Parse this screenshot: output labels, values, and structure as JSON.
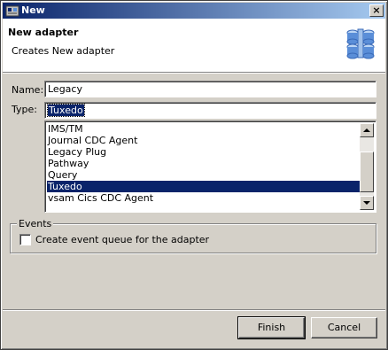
{
  "window": {
    "title": "New",
    "close_label": "×"
  },
  "banner": {
    "title": "New adapter",
    "description": "Creates New adapter",
    "icon": "adapter-cylinders-icon"
  },
  "form": {
    "name_label": "Name:",
    "name_value": "Legacy",
    "type_label": "Type:",
    "type_value": "Tuxedo"
  },
  "type_list": {
    "items": [
      "IMS/TM",
      "Journal CDC Agent",
      "Legacy Plug",
      "Pathway",
      "Query",
      "Tuxedo",
      "vsam Cics CDC Agent"
    ],
    "selected": "Tuxedo"
  },
  "events": {
    "legend": "Events",
    "checkbox_label": "Create event queue for the adapter",
    "checked": false
  },
  "buttons": {
    "finish": "Finish",
    "cancel": "Cancel"
  },
  "colors": {
    "title_gradient_start": "#0a246a",
    "title_gradient_end": "#a6caf0",
    "selection": "#0a246a",
    "face": "#d4d0c8",
    "icon_blue": "#5a8ed8"
  }
}
